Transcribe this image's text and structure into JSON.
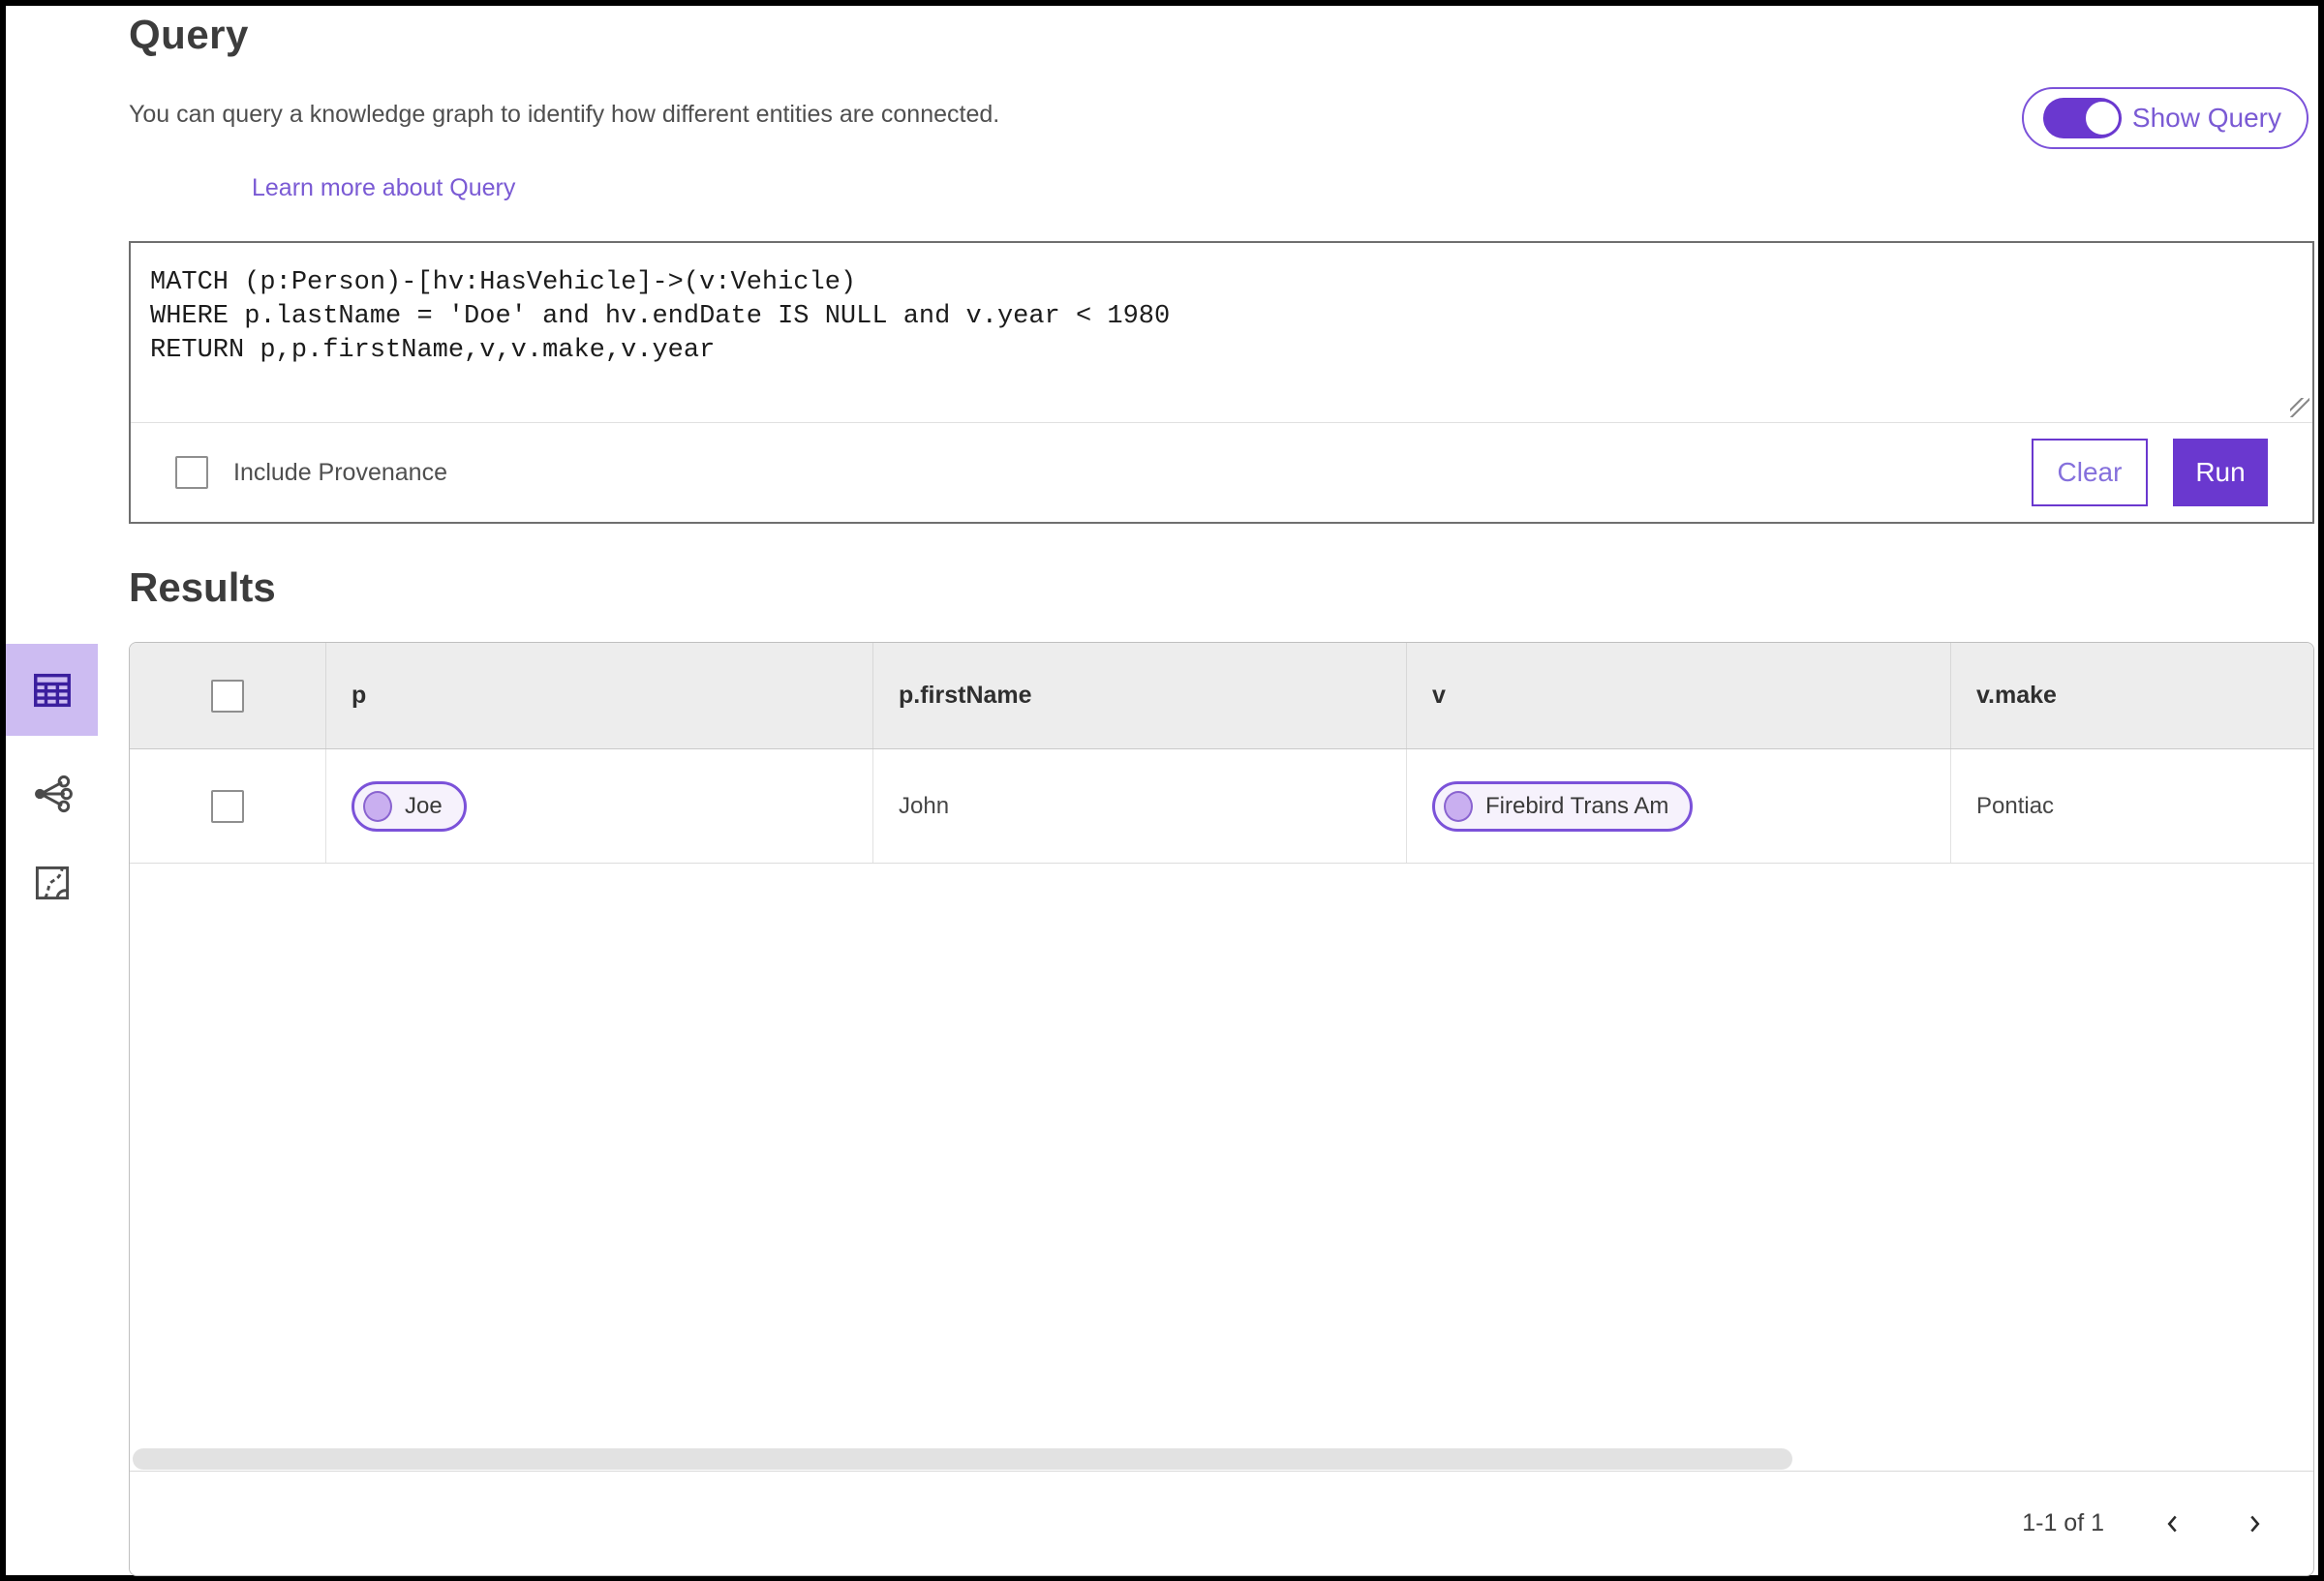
{
  "header": {
    "title": "Query",
    "description": "You can query a knowledge graph to identify how different entities are connected.",
    "learn_more_label": "Learn more about Query",
    "show_query_label": "Show Query",
    "show_query_on": true
  },
  "query_panel": {
    "code": "MATCH (p:Person)-[hv:HasVehicle]->(v:Vehicle)\nWHERE p.lastName = 'Doe' and hv.endDate IS NULL and v.year < 1980\nRETURN p,p.firstName,v,v.make,v.year",
    "include_provenance_label": "Include Provenance",
    "include_provenance_checked": false,
    "clear_label": "Clear",
    "run_label": "Run"
  },
  "results": {
    "title": "Results",
    "columns": [
      "p",
      "p.firstName",
      "v",
      "v.make"
    ],
    "rows": [
      {
        "p": "Joe",
        "p_firstName": "John",
        "v": "Firebird Trans Am",
        "v_make": "Pontiac",
        "selected": false
      }
    ],
    "pagination": {
      "range_label": "1-1 of 1"
    }
  },
  "view_rail": {
    "tools": [
      {
        "name": "table-view",
        "active": true
      },
      {
        "name": "link-chart-view",
        "active": false
      },
      {
        "name": "map-view",
        "active": false
      }
    ]
  },
  "colors": {
    "accent": "#6a38cf",
    "accent-mid": "#7b52d9",
    "accent-link": "#7a5ad4",
    "accent-light": "#cdbcf2",
    "chip-fill": "#f6f2fc",
    "chip-dot": "#c9aff0"
  }
}
